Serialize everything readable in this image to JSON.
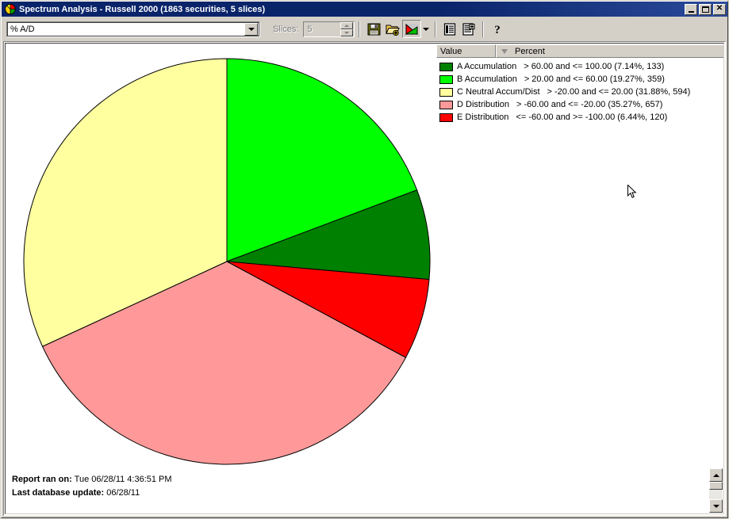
{
  "window": {
    "title": "Spectrum Analysis - Russell 2000 (1863 securities, 5 slices)",
    "icon": "pie-chart-icon",
    "caption_buttons": [
      {
        "name": "minimize",
        "glyph": "_"
      },
      {
        "name": "maximize",
        "glyph": "□"
      },
      {
        "name": "close",
        "glyph": "✕"
      }
    ]
  },
  "toolbar": {
    "indicator_combo": {
      "value": "% A/D",
      "placeholder": "% A/D",
      "dropdown_icon": "chevron-down-icon"
    },
    "slices_label": "Slices:",
    "slices_value": "5",
    "slices_enabled": false,
    "buttons": [
      {
        "name": "save-button",
        "icon": "floppy-disk-icon",
        "label": "Save"
      },
      {
        "name": "open-button",
        "icon": "open-folder-plus-icon",
        "label": "Open"
      },
      {
        "name": "chart-type-button",
        "icon": "pie-chart-icon",
        "label": "Chart Type",
        "pressed": true
      },
      {
        "name": "chart-type-dropdown",
        "icon": "chevron-down-icon",
        "label": "Chart Options"
      },
      {
        "name": "report-list-button",
        "icon": "list-report-icon",
        "label": "Report"
      },
      {
        "name": "detail-list-button",
        "icon": "detail-list-icon",
        "label": "Details"
      },
      {
        "name": "help-button",
        "icon": "question-mark-icon",
        "label": "Help"
      }
    ]
  },
  "legend": {
    "columns": [
      "Value",
      "Percent"
    ],
    "sort_column": "Percent",
    "sort_direction": "descending",
    "sort_icon": "sort-descending-icon",
    "rows": [
      {
        "color": "#008000",
        "name": "A Accumulation",
        "desc": "> 60.00 and <= 100.00 (7.14%, 133)"
      },
      {
        "color": "#00FF00",
        "name": "B Accumulation",
        "desc": "> 20.00 and <= 60.00 (19.27%, 359)"
      },
      {
        "color": "#FFFFA0",
        "name": "C Neutral Accum/Dist",
        "desc": "> -20.00 and <= 20.00 (31.88%, 594)"
      },
      {
        "color": "#FF9999",
        "name": "D Distribution",
        "desc": "> -60.00 and <= -20.00 (35.27%, 657)"
      },
      {
        "color": "#FF0000",
        "name": "E Distribution",
        "desc": "<= -60.00 and >= -100.00 (6.44%, 120)"
      }
    ]
  },
  "footer": {
    "report_ran_label": "Report ran on:",
    "report_ran_value": "Tue 06/28/11 4:36:51 PM",
    "db_update_label": "Last database update:",
    "db_update_value": "06/28/11"
  },
  "scrollbar": {
    "up_icon": "triangle-up-icon",
    "down_icon": "triangle-down-icon",
    "thumb": "scroll-thumb"
  },
  "chart_data": {
    "type": "pie",
    "title": "Spectrum Analysis - Russell 2000",
    "subtitle": "1863 securities, 5 slices",
    "categories": [
      "B Accumulation",
      "A Accumulation",
      "E Distribution",
      "D Distribution",
      "C Neutral Accum/Dist"
    ],
    "values": [
      19.27,
      7.14,
      6.44,
      35.27,
      31.88
    ],
    "counts": [
      359,
      133,
      120,
      657,
      594
    ],
    "colors": [
      "#00FF00",
      "#008000",
      "#FF0000",
      "#FF9999",
      "#FFFFA0"
    ],
    "start_angle_deg": 0,
    "direction": "clockwise",
    "center": [
      279,
      327
    ],
    "radius": 256,
    "stroke": "#000000",
    "legend_position": "right",
    "grid": false,
    "total_securities": 1863,
    "total_slices": 5
  }
}
